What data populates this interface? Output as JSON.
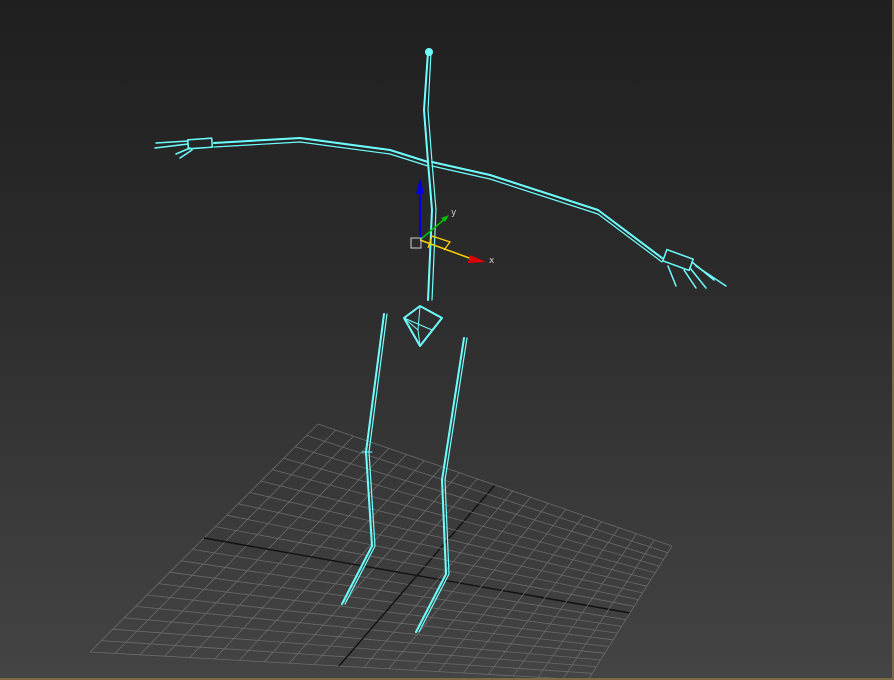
{
  "viewport": {
    "gizmo_labels": {
      "x": "x",
      "y": "y"
    },
    "selection_color": "#6fffff",
    "grid_color": "#6a6a6a",
    "grid_axis_color": "#111111",
    "background_top": "#1f1f1f",
    "background_bottom": "#444444",
    "gizmo_colors": {
      "x": "#e00000",
      "y": "#00c000",
      "z": "#0000e0",
      "plane": "#ffd000"
    }
  }
}
